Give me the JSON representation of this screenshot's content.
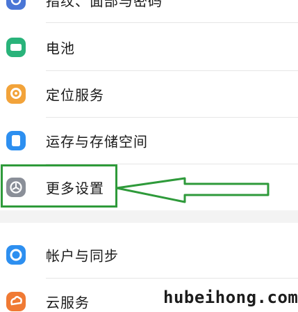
{
  "settings_list": {
    "items": [
      {
        "label": "指纹、面部与密码",
        "icon": "fingerprint-icon"
      },
      {
        "label": "电池",
        "icon": "battery-icon"
      },
      {
        "label": "定位服务",
        "icon": "location-icon"
      },
      {
        "label": "运存与存储空间",
        "icon": "storage-icon"
      },
      {
        "label": "更多设置",
        "icon": "gear-icon"
      },
      {
        "label": "帐户与同步",
        "icon": "account-sync-icon"
      },
      {
        "label": "云服务",
        "icon": "cloud-service-icon"
      }
    ]
  },
  "annotation": {
    "highlight_color": "#2e9a3a",
    "pointer": "arrow-pointing-left"
  },
  "watermark": {
    "text": "hubeihong.com"
  },
  "colors": {
    "fingerprint_icon": "#4a76d6",
    "battery_icon": "#29b37a",
    "location_icon": "#f2a33a",
    "storage_icon": "#2d8ff0",
    "gear_icon": "#8a8f98",
    "account_icon": "#2d8ff0",
    "cloud_icon": "#f07a34"
  }
}
